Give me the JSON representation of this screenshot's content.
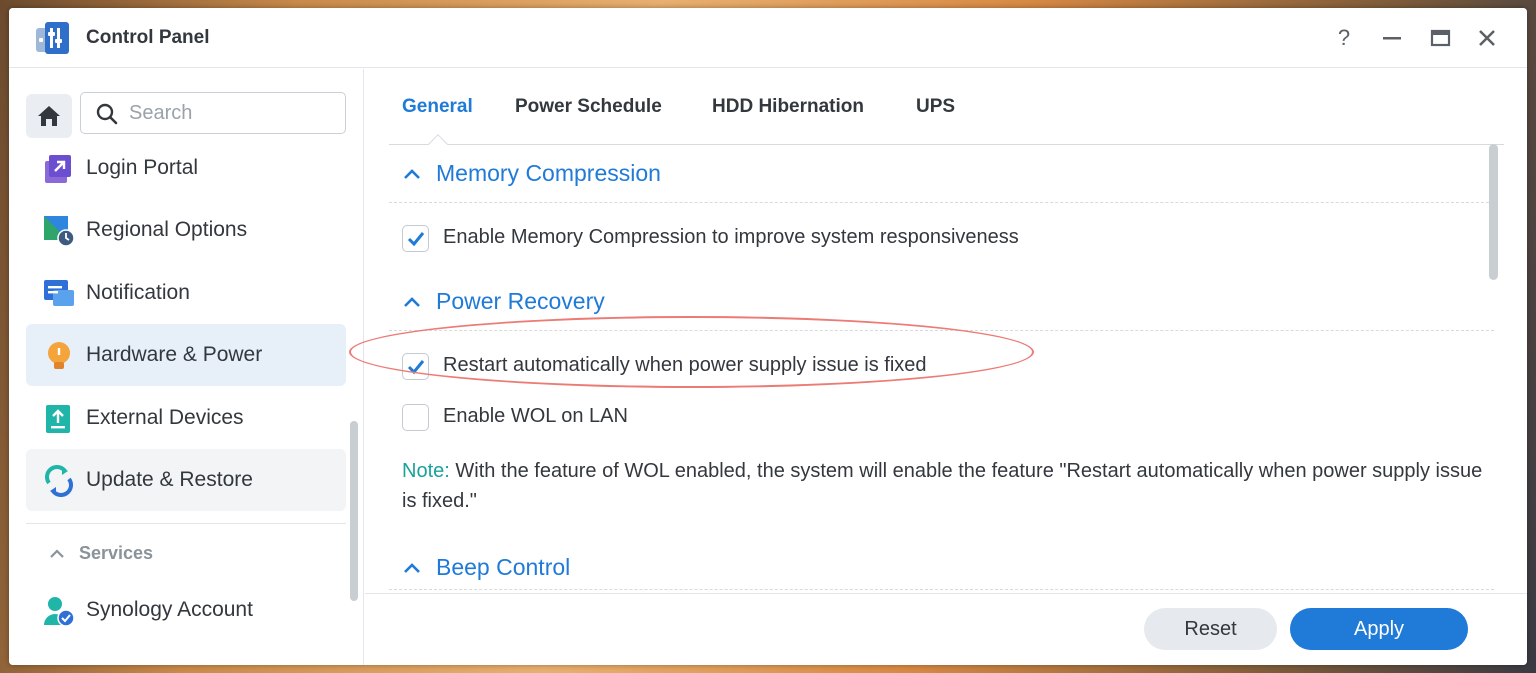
{
  "window": {
    "title": "Control Panel",
    "controls": {
      "help": "?",
      "minimize": "—",
      "maximize": "▭",
      "close": "✕"
    }
  },
  "sidebar": {
    "search_placeholder": "Search",
    "items": [
      {
        "label": "Login Portal",
        "icon": "login-portal-icon"
      },
      {
        "label": "Regional Options",
        "icon": "regional-options-icon"
      },
      {
        "label": "Notification",
        "icon": "notification-icon"
      },
      {
        "label": "Hardware & Power",
        "icon": "hardware-power-icon",
        "active": true
      },
      {
        "label": "External Devices",
        "icon": "external-devices-icon"
      },
      {
        "label": "Update & Restore",
        "icon": "update-restore-icon"
      }
    ],
    "section_header": "Services",
    "service_items": [
      {
        "label": "Synology Account",
        "icon": "synology-account-icon"
      }
    ]
  },
  "tabs": [
    {
      "label": "General",
      "active": true
    },
    {
      "label": "Power Schedule"
    },
    {
      "label": "HDD Hibernation"
    },
    {
      "label": "UPS"
    }
  ],
  "sections": {
    "memory_compression": {
      "title": "Memory Compression",
      "option": {
        "label": "Enable Memory Compression to improve system responsiveness",
        "checked": true
      }
    },
    "power_recovery": {
      "title": "Power Recovery",
      "options": [
        {
          "label": "Restart automatically when power supply issue is fixed",
          "checked": true
        },
        {
          "label": "Enable WOL on LAN",
          "checked": false
        }
      ],
      "note_label": "Note:",
      "note_text": " With the feature of WOL enabled, the system will enable the feature \"Restart automatically when power supply issue is fixed.\""
    },
    "beep_control": {
      "title": "Beep Control"
    }
  },
  "footer": {
    "reset_label": "Reset",
    "apply_label": "Apply"
  },
  "colors": {
    "accent": "#1f7ad8",
    "note": "#1aa39a",
    "highlight": "#ec7b75"
  }
}
